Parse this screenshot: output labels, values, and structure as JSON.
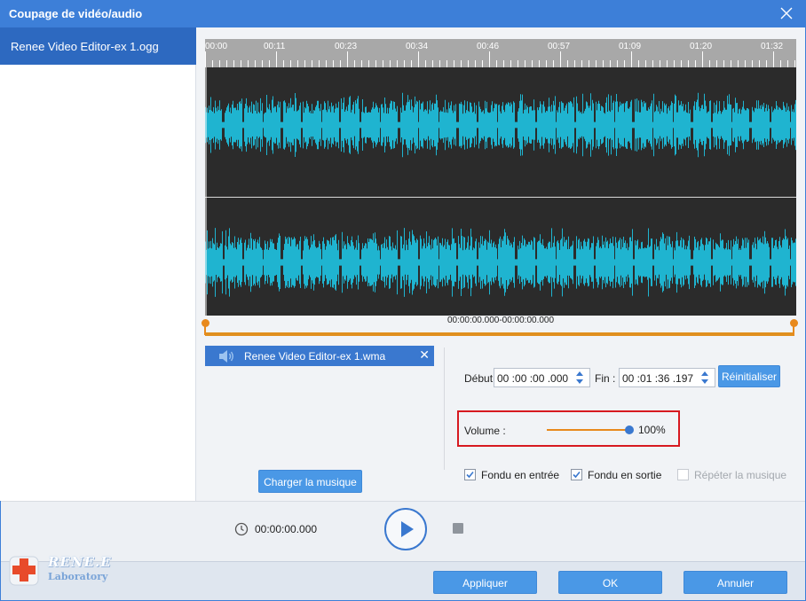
{
  "window": {
    "title": "Coupage de vidéo/audio"
  },
  "sidebar": {
    "items": [
      {
        "label": "Renee Video Editor-ex 1.ogg"
      }
    ]
  },
  "timeline": {
    "ticks": [
      "00:00",
      "00:11",
      "00:23",
      "00:34",
      "00:46",
      "00:57",
      "01:09",
      "01:20",
      "01:32"
    ],
    "range_text": "00:00:00.000-00:00:00.000"
  },
  "audio_track": {
    "name": "Renee Video Editor-ex 1.wma",
    "icon": "speaker-icon"
  },
  "buttons": {
    "load_music": "Charger la musique",
    "reset": "Réinitialiser",
    "apply": "Appliquer",
    "ok": "OK",
    "cancel": "Annuler"
  },
  "trim": {
    "start_label": "Début",
    "start_value": "00 :00 :00 .000",
    "end_label": "Fin :",
    "end_value": "00 :01 :36 .197"
  },
  "volume": {
    "label": "Volume :",
    "value_text": "100%",
    "level": 1.0
  },
  "options": {
    "fade_in": {
      "label": "Fondu en entrée",
      "checked": true
    },
    "fade_out": {
      "label": "Fondu en sortie",
      "checked": true
    },
    "repeat_music": {
      "label": "Répéter la musique",
      "checked": false,
      "disabled": true
    }
  },
  "playback": {
    "time": "00:00:00.000"
  },
  "logo": {
    "brand": "RENE.E",
    "sub": "Laboratory"
  },
  "colors": {
    "titlebar": "#3d7fd8",
    "waveform": "#1fb4d0",
    "waveform_bg": "#2b2b2b",
    "accent_orange": "#e8891c",
    "button_blue": "#4a98e6",
    "highlight_red": "#d71920"
  }
}
